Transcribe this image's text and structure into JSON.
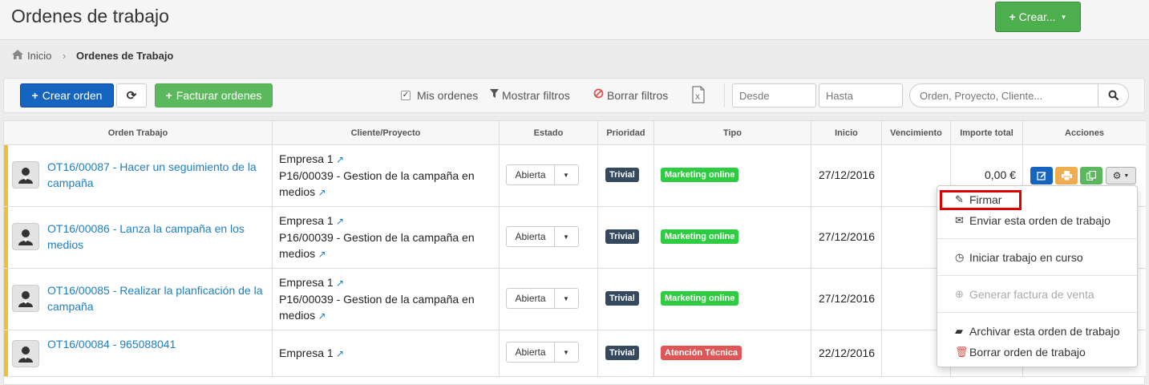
{
  "header": {
    "title": "Ordenes de trabajo",
    "create_button": "Crear..."
  },
  "breadcrumb": {
    "home": "Inicio",
    "current": "Ordenes de Trabajo"
  },
  "toolbar": {
    "create_order": "Crear orden",
    "invoice_orders": "Facturar ordenes",
    "my_orders": "Mis ordenes",
    "show_filters": "Mostrar filtros",
    "clear_filters": "Borrar filtros",
    "from_placeholder": "Desde",
    "to_placeholder": "Hasta",
    "search_placeholder": "Orden, Proyecto, Cliente..."
  },
  "table": {
    "headers": [
      "Orden Trabajo",
      "Cliente/Proyecto",
      "Estado",
      "Prioridad",
      "Tipo",
      "Inicio",
      "Vencimiento",
      "Importe total",
      "Acciones"
    ],
    "rows": [
      {
        "order": "OT16/00087 - Hacer un seguimiento de la campaña",
        "client": "Empresa 1",
        "project": "P16/00039 - Gestion de la campaña en medios",
        "status": "Abierta",
        "priority": "Trivial",
        "type": "Marketing online",
        "start": "27/12/2016",
        "amount": "0,00 €"
      },
      {
        "order": "OT16/00086 - Lanza la campaña en los medios",
        "client": "Empresa 1",
        "project": "P16/00039 - Gestion de la campaña en medios",
        "status": "Abierta",
        "priority": "Trivial",
        "type": "Marketing online",
        "start": "27/12/2016",
        "amount": ""
      },
      {
        "order": "OT16/00085 - Realizar la planficación de la campaña",
        "client": "Empresa 1",
        "project": "P16/00039 - Gestion de la campaña en medios",
        "status": "Abierta",
        "priority": "Trivial",
        "type": "Marketing online",
        "start": "27/12/2016",
        "amount": ""
      },
      {
        "order": "OT16/00084 - 965088041",
        "client": "Empresa 1",
        "project": "",
        "status": "Abierta",
        "priority": "Trivial",
        "type": "Atención Técnica",
        "start": "22/12/2016",
        "amount": ""
      }
    ]
  },
  "actions_menu": {
    "sign": "Firmar",
    "send": "Enviar esta orden de trabajo",
    "start_work": "Iniciar trabajo en curso",
    "generate_invoice": "Generar factura de venta",
    "archive": "Archivar esta orden de trabajo",
    "delete": "Borrar orden de trabajo"
  },
  "colors": {
    "accent_green": "#5cb85c",
    "primary_blue": "#1565c0",
    "priority_badge": "#34495e",
    "type_marketing": "#2ecc40",
    "type_tech": "#e05555",
    "row_stripe": "#f0c030",
    "highlight": "#e00000"
  }
}
